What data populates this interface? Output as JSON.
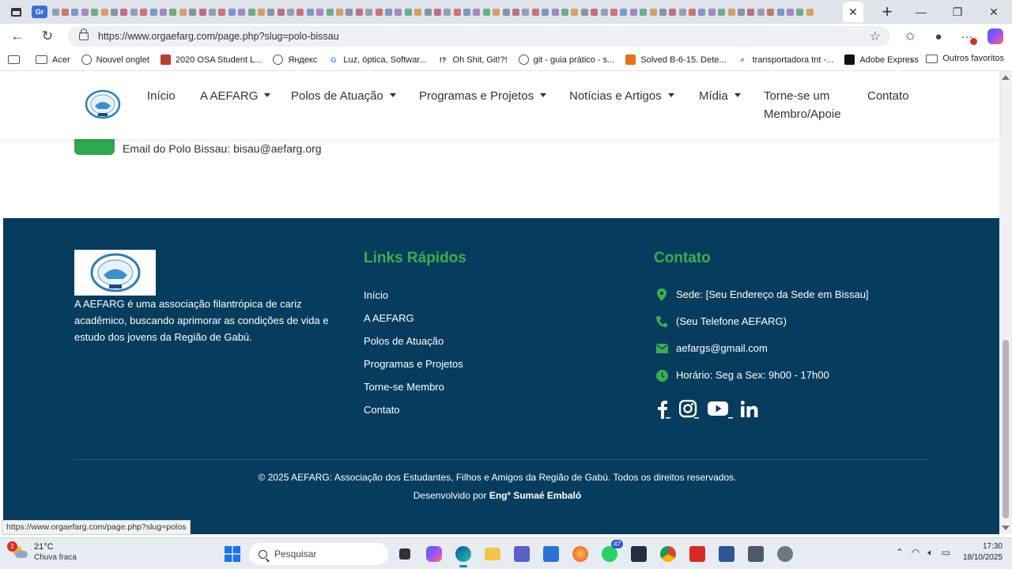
{
  "browser": {
    "active_tab_label": "Gr",
    "address_url": "https://www.orgaefarg.com/page.php?slug=polo-bissau",
    "status_link": "https://www.orgaefarg.com/page.php?slug=polos",
    "bookmarks": [
      {
        "label": "Acer",
        "icon": "folder-icon",
        "color": "#555555"
      },
      {
        "label": "Nouvel onglet",
        "icon": "globe-icon",
        "color": "#555555"
      },
      {
        "label": "2020 OSA Student L...",
        "icon": "osa-icon",
        "color": "#c0392b"
      },
      {
        "label": "Яндекс",
        "icon": "globe-icon",
        "color": "#555555"
      },
      {
        "label": "Luz, óptica, Softwar...",
        "icon": "google-icon",
        "color": "#4285f4"
      },
      {
        "label": "Oh Shit, Git!?!",
        "icon": "bang-icon",
        "color": "#222222"
      },
      {
        "label": "git - guia prático - s...",
        "icon": "globe-icon",
        "color": "#555555"
      },
      {
        "label": "Solved B-6-15. Dete...",
        "icon": "chegg-icon",
        "color": "#e8711a"
      },
      {
        "label": "transportadora tnt -...",
        "icon": "search-icon",
        "color": "#1a5ad8"
      },
      {
        "label": "Adobe Express",
        "icon": "adobe-icon",
        "color": "#111111"
      }
    ],
    "bookmarks_other": "Outros favoritos"
  },
  "site": {
    "nav": [
      {
        "label": "Início",
        "dropdown": false
      },
      {
        "label": "A AEFARG",
        "dropdown": true
      },
      {
        "label": "Polos de Atuação",
        "dropdown": true
      },
      {
        "label": "Programas e Projetos",
        "dropdown": true
      },
      {
        "label": "Notícias e Artigos",
        "dropdown": true
      },
      {
        "label": "Mídia",
        "dropdown": true
      },
      {
        "label": "Torne-se um Membro/Apoie",
        "dropdown": false
      },
      {
        "label": "Contato",
        "dropdown": false
      }
    ],
    "email_line": "Email do Polo Bissau: bisau@aefarg.org",
    "footer": {
      "about": "A AEFARG é uma associação filantrópica de cariz acadêmico, buscando aprimorar as condições de vida e estudo dos jovens da Região de Gabú.",
      "links_heading": "Links Rápidos",
      "links": [
        "Início",
        "A AEFARG",
        "Polos de Atuação",
        "Programas e Projetos",
        "Torne-se Membro",
        "Contato"
      ],
      "contact_heading": "Contato",
      "contact": [
        {
          "icon": "map-pin-icon",
          "text": "Sede: [Seu Endereço da Sede em Bissau]"
        },
        {
          "icon": "phone-icon",
          "text": "(Seu Telefone AEFARG)"
        },
        {
          "icon": "envelope-icon",
          "text": "aefargs@gmail.com"
        },
        {
          "icon": "clock-icon",
          "text": "Horário: Seg a Sex: 9h00 - 17h00"
        }
      ],
      "social": [
        "facebook-icon",
        "instagram-icon",
        "youtube-icon",
        "linkedin-icon"
      ],
      "copyright": "© 2025 AEFARG: Associação dos Estudantes, Filhos e Amigos da Região de Gabú. Todos os direitos reservados.",
      "developed_by_prefix": "Desenvolvido por",
      "developed_by_name": "Engº Sumaé Embaló"
    },
    "colors": {
      "footer_bg": "#063d5e",
      "accent_green": "#3bb04a",
      "email_icon_bg": "#2fa84f"
    }
  },
  "taskbar": {
    "weather_badge": "2",
    "weather_temp": "21°C",
    "weather_desc": "Chuva fraca",
    "search_placeholder": "Pesquisar",
    "teams_badge": "47",
    "time": "17:30",
    "date": "18/10/2025"
  }
}
